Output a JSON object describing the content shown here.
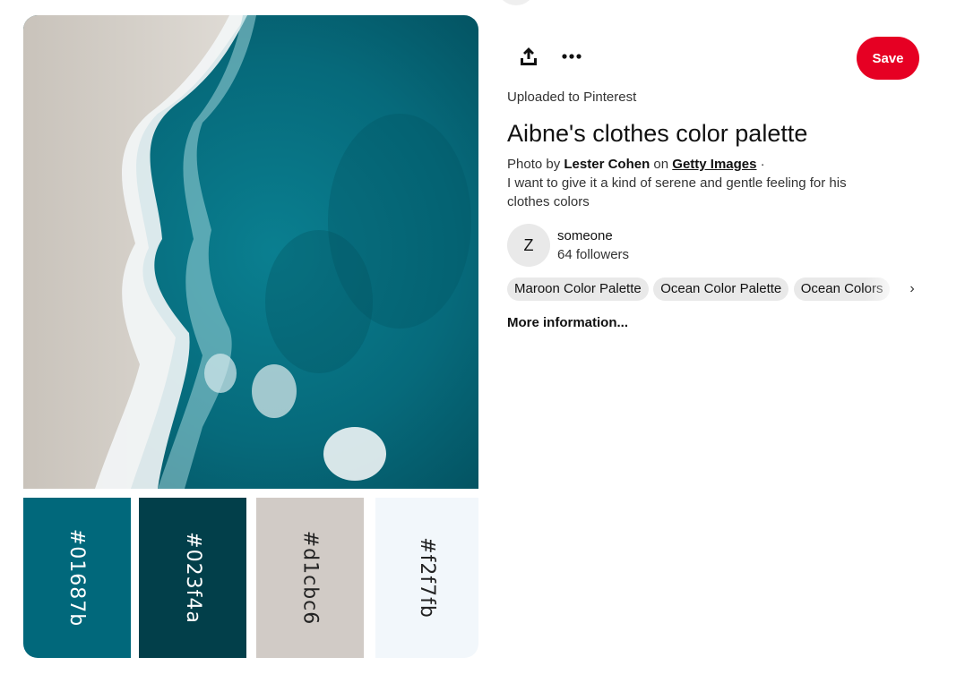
{
  "pin": {
    "palette": [
      {
        "label": "#01687b",
        "color": "#01687b",
        "text_color": "#ffffff"
      },
      {
        "label": "#023f4a",
        "color": "#023f4a",
        "text_color": "#ffffff"
      },
      {
        "label": "#d1cbc6",
        "color": "#d1cbc6",
        "text_color": "#222222"
      },
      {
        "label": "#f2f7fb",
        "color": "#f2f7fb",
        "text_color": "#222222"
      }
    ]
  },
  "actions": {
    "share_icon": "share-upload-icon",
    "more_icon": "ellipsis-icon",
    "save_label": "Save",
    "save_color": "#e60023"
  },
  "details": {
    "uploaded_text": "Uploaded to Pinterest",
    "title": "Aibne's clothes color palette",
    "photo_by_prefix": "Photo by",
    "photographer": "Lester Cohen",
    "on_word": "on",
    "source_link": "Getty Images",
    "separator": "·",
    "description": "I want to give it a kind of serene and gentle feeling for his clothes colors"
  },
  "creator": {
    "avatar_initial": "Z",
    "name": "someone",
    "followers": "64 followers"
  },
  "tags": [
    "Maroon Color Palette",
    "Ocean Color Palette",
    "Ocean Colors"
  ],
  "tags_next_icon": "chevron-right-icon",
  "more_info_label": "More information..."
}
